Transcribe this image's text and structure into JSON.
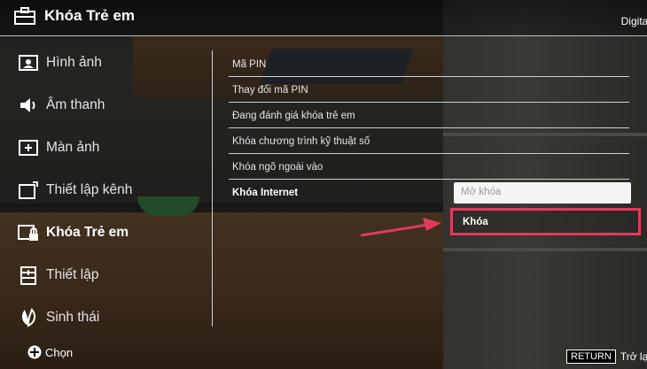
{
  "header": {
    "title": "Khóa Trẻ em",
    "right_text": "Digital"
  },
  "sidebar": {
    "items": [
      {
        "label": "Hình ảnh",
        "icon": "picture-icon"
      },
      {
        "label": "Âm thanh",
        "icon": "speaker-icon"
      },
      {
        "label": "Màn ảnh",
        "icon": "screen-icon"
      },
      {
        "label": "Thiết lập kênh",
        "icon": "channel-setup-icon"
      },
      {
        "label": "Khóa Trẻ em",
        "icon": "parental-lock-icon",
        "active": true
      },
      {
        "label": "Thiết lập",
        "icon": "settings-icon"
      },
      {
        "label": "Sinh thái",
        "icon": "eco-icon"
      }
    ]
  },
  "menu": {
    "items": [
      {
        "label": "Mã PIN"
      },
      {
        "label": "Thay đổi mã PIN"
      },
      {
        "label": "Đang đánh giá khóa trẻ em"
      },
      {
        "label": "Khóa chương trình kỹ thuật số"
      },
      {
        "label": "Khóa ngõ ngoài vào"
      },
      {
        "label": "Khóa Internet",
        "selected": true
      }
    ]
  },
  "dropdown": {
    "options": [
      {
        "label": "Mở khóa"
      },
      {
        "label": "Khóa",
        "highlighted": true
      }
    ],
    "highlight_color": "#e23a5c"
  },
  "footer": {
    "select_label": "Chọn",
    "return_key": "RETURN",
    "return_label": "Trở lại"
  }
}
